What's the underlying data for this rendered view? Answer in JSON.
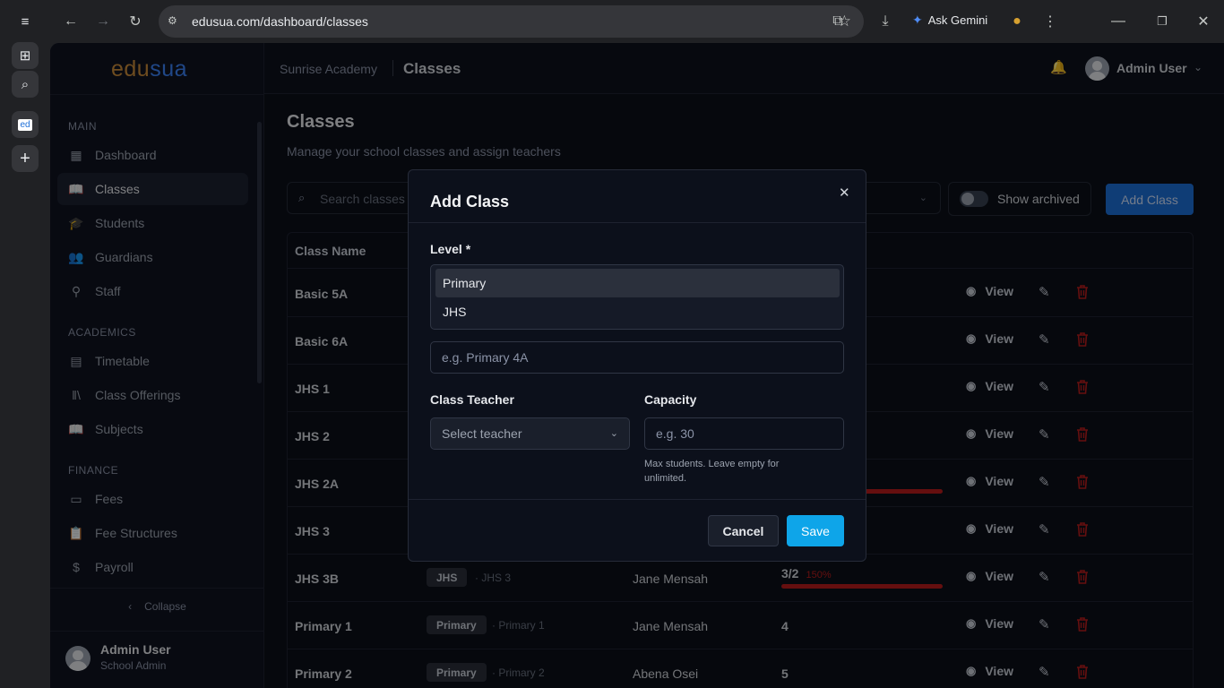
{
  "browser": {
    "url": "edusua.com/dashboard/classes",
    "gemini_label": "Ask Gemini",
    "tab_favicon_text": "ed"
  },
  "logo": {
    "part1": "edu",
    "part2": "sua"
  },
  "header": {
    "school": "Sunrise Academy",
    "page": "Classes",
    "user": "Admin User"
  },
  "sidebar": {
    "sections": [
      "MAIN",
      "ACADEMICS",
      "FINANCE"
    ],
    "items": [
      {
        "label": "Dashboard",
        "icon": "grid-icon"
      },
      {
        "label": "Classes",
        "icon": "book-icon",
        "active": true
      },
      {
        "label": "Students",
        "icon": "graduation-cap-icon"
      },
      {
        "label": "Guardians",
        "icon": "users-icon"
      },
      {
        "label": "Staff",
        "icon": "user-cog-icon"
      },
      {
        "label": "Timetable",
        "icon": "calendar-icon"
      },
      {
        "label": "Class Offerings",
        "icon": "library-icon"
      },
      {
        "label": "Subjects",
        "icon": "book-open-icon"
      },
      {
        "label": "Fees",
        "icon": "wallet-icon"
      },
      {
        "label": "Fee Structures",
        "icon": "clipboard-icon"
      },
      {
        "label": "Payroll",
        "icon": "dollar-icon"
      }
    ],
    "collapse_label": "Collapse",
    "footer_user": {
      "name": "Admin User",
      "role": "School Admin"
    }
  },
  "page": {
    "title": "Classes",
    "subtitle": "Manage your school classes and assign teachers",
    "search_placeholder": "Search classes",
    "show_archived_label": "Show archived",
    "add_button": "Add Class"
  },
  "table": {
    "headers": [
      "Class Name"
    ],
    "view_label": "View",
    "rows": [
      {
        "name": "Basic 5A"
      },
      {
        "name": "Basic 6A"
      },
      {
        "name": "JHS 1"
      },
      {
        "name": "JHS 2"
      },
      {
        "name": "JHS 2A"
      },
      {
        "name": "JHS 3"
      },
      {
        "name": "JHS 3B",
        "badge": "JHS",
        "level": "· JHS 3",
        "teacher": "Jane Mensah",
        "enrollment": "3/2",
        "percent": "150%",
        "fill": 1.0
      },
      {
        "name": "Primary 1",
        "badge": "Primary",
        "level": "· Primary 1",
        "teacher": "Jane Mensah",
        "enrollment": "4"
      },
      {
        "name": "Primary 2",
        "badge": "Primary",
        "level": "· Primary 2",
        "teacher": "Abena Osei",
        "enrollment": "5"
      }
    ]
  },
  "modal": {
    "title": "Add Class",
    "level_label": "Level *",
    "level_options": [
      "Primary",
      "JHS"
    ],
    "highlighted_option": "Primary",
    "name_placeholder": "e.g. Primary 4A",
    "teacher_label": "Class Teacher",
    "teacher_placeholder": "Select teacher",
    "capacity_label": "Capacity",
    "capacity_placeholder": "e.g. 30",
    "capacity_helper": "Max students. Leave empty for unlimited.",
    "cancel": "Cancel",
    "save": "Save"
  },
  "colors": {
    "accent": "#0ea5e9",
    "add_button": "#1d6fd8",
    "danger": "#b91c1c",
    "logo_edu": "#c88a3a",
    "logo_sua": "#3b82f6"
  }
}
